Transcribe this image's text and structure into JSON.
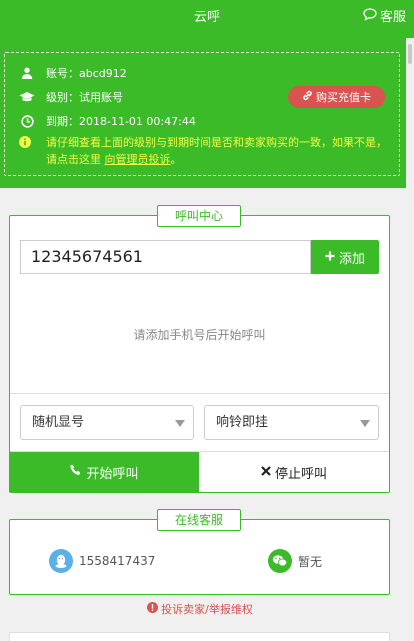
{
  "header": {
    "title": "云呼",
    "service_label": "客服"
  },
  "account": {
    "account_label": "账号：abcd912",
    "level_label": "级别：试用账号",
    "expiry_label": "到期：2018-11-01 00:47:44",
    "warning_text": "请仔细查看上面的级别与到期时间是否和卖家购买的一致，如果不是，请点击这里",
    "warning_link": "向管理员投诉",
    "warning_end": "。",
    "buy_button": "购买充值卡"
  },
  "call_center": {
    "legend": "呼叫中心",
    "phone_value": "12345674561",
    "add_button": "添加",
    "empty_hint": "请添加手机号后开始呼叫",
    "caller_id_select": "随机显号",
    "hangup_select": "响铃即挂",
    "start_button": "开始呼叫",
    "stop_button": "停止呼叫"
  },
  "online_service": {
    "legend": "在线客服",
    "qq": "1558417437",
    "wechat": "暂无"
  },
  "footer": {
    "complaint_link": "投诉卖家/举报维权"
  },
  "colors": {
    "brand_green": "#3cbb28",
    "warn_yellow": "#f4ff47",
    "danger_red": "#d9534f",
    "qq_blue": "#5bb0e6",
    "wechat_green": "#3cbb28"
  }
}
